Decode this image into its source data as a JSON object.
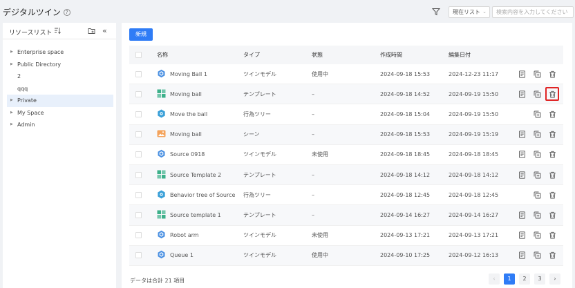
{
  "header": {
    "title": "デジタルツイン",
    "help_icon": "?",
    "scope_select": "現在リスト",
    "search_placeholder": "検索内容を入力してください"
  },
  "sidebar": {
    "title": "リソースリスト",
    "items": [
      {
        "label": "Enterprise space",
        "caret": true
      },
      {
        "label": "Public Directory",
        "caret": true
      },
      {
        "label": "2",
        "caret": false
      },
      {
        "label": "qqq",
        "caret": false
      },
      {
        "label": "Private",
        "caret": true,
        "selected": true
      },
      {
        "label": "My Space",
        "caret": true
      },
      {
        "label": "Admin",
        "caret": true
      }
    ]
  },
  "toolbar": {
    "new_label": "新規"
  },
  "table": {
    "columns": [
      "名称",
      "タイプ",
      "状態",
      "作成時間",
      "編集日付"
    ],
    "rows": [
      {
        "name": "Moving Ball 1",
        "type": "ツインモデル",
        "state": "使用中",
        "created": "2024-09-18 15:53",
        "updated": "2024-12-23 11:17",
        "icon": "twin-model-icon",
        "detail": true
      },
      {
        "name": "Moving ball",
        "type": "テンプレート",
        "state": "–",
        "created": "2024-09-18 14:52",
        "updated": "2024-09-19 15:50",
        "icon": "template-icon",
        "detail": true
      },
      {
        "name": "Move the ball",
        "type": "行為ツリー",
        "state": "–",
        "created": "2024-09-18 15:04",
        "updated": "2024-09-19 15:50",
        "icon": "behavior-tree-icon",
        "detail": false
      },
      {
        "name": "Moving ball",
        "type": "シーン",
        "state": "–",
        "created": "2024-09-18 15:53",
        "updated": "2024-09-19 15:19",
        "icon": "scene-icon",
        "detail": true
      },
      {
        "name": "Source 0918",
        "type": "ツインモデル",
        "state": "未使用",
        "created": "2024-09-18 18:45",
        "updated": "2024-09-18 18:45",
        "icon": "twin-model-icon",
        "detail": true
      },
      {
        "name": "Source Template 2",
        "type": "テンプレート",
        "state": "–",
        "created": "2024-09-18 14:12",
        "updated": "2024-09-18 14:12",
        "icon": "template-icon",
        "detail": true
      },
      {
        "name": "Behavior tree of Source",
        "type": "行為ツリー",
        "state": "–",
        "created": "2024-09-18 12:45",
        "updated": "2024-09-18 12:45",
        "icon": "behavior-tree-icon",
        "detail": false
      },
      {
        "name": "Source template 1",
        "type": "テンプレート",
        "state": "–",
        "created": "2024-09-14 16:27",
        "updated": "2024-09-14 16:27",
        "icon": "template-icon",
        "detail": true
      },
      {
        "name": "Robot arm",
        "type": "ツインモデル",
        "state": "未使用",
        "created": "2024-09-13 17:21",
        "updated": "2024-09-13 17:21",
        "icon": "twin-model-icon",
        "detail": true
      },
      {
        "name": "Queue 1",
        "type": "ツインモデル",
        "state": "使用中",
        "created": "2024-09-10 17:25",
        "updated": "2024-09-12 16:13",
        "icon": "twin-model-icon",
        "detail": true
      }
    ]
  },
  "footer": {
    "total": "データは合計 21 項目",
    "pages": [
      "1",
      "2",
      "3"
    ],
    "prev": "‹",
    "next": "›",
    "current_page": 1
  },
  "colors": {
    "accent": "#2f7cf6",
    "highlight": "#e02424",
    "twin": "#4a90e2",
    "template": "#3cb08a",
    "behavior": "#3aa0d8",
    "scene": "#f4a35c"
  }
}
